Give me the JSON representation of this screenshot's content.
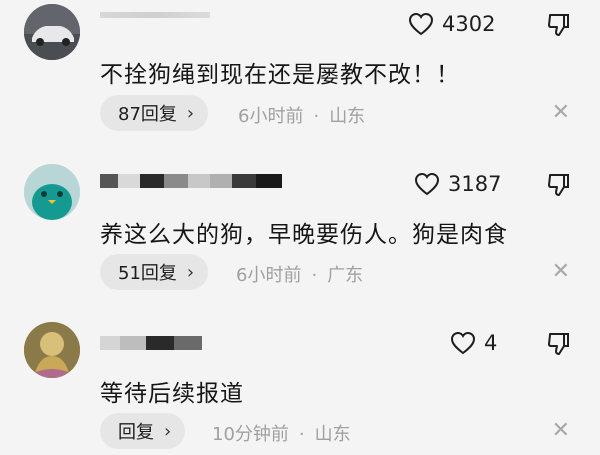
{
  "comments": [
    {
      "likes": "4302",
      "text": "不拴狗绳到现在还是屡教不改！！",
      "reply_label": "87回复",
      "time": "6小时前",
      "location": "山东"
    },
    {
      "likes": "3187",
      "text": "养这么大的狗，早晚要伤人。狗是肉食",
      "reply_label": "51回复",
      "time": "6小时前",
      "location": "广东"
    },
    {
      "likes": "4",
      "text": "等待后续报道",
      "reply_label": "回复",
      "time": "10分钟前",
      "location": "山东"
    }
  ],
  "icons": {
    "like": "heart-outline-icon",
    "dislike": "thumbs-down-icon",
    "dismiss": "close-icon",
    "expand": "chevron-right-icon"
  },
  "glyphs": {
    "chevron": "›",
    "separator": "·",
    "close": "✕"
  }
}
